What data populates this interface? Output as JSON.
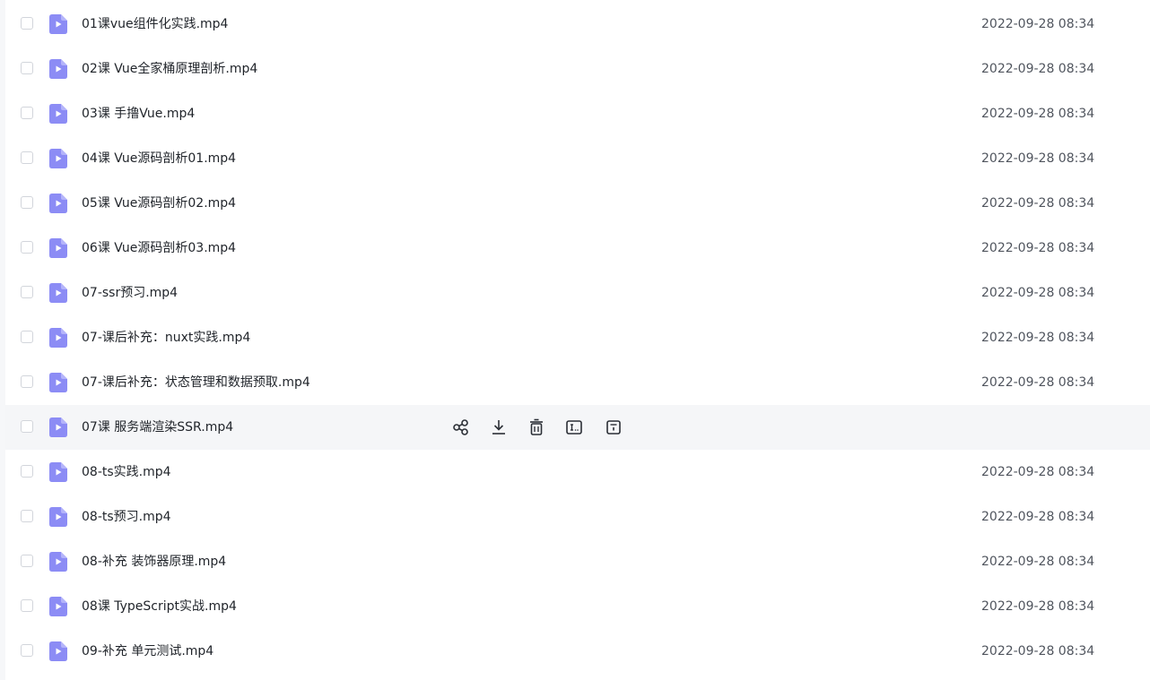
{
  "files": [
    {
      "name": "01课vue组件化实践.mp4",
      "date": "2022-09-28 08:34"
    },
    {
      "name": "02课 Vue全家桶原理剖析.mp4",
      "date": "2022-09-28 08:34"
    },
    {
      "name": "03课 手撸Vue.mp4",
      "date": "2022-09-28 08:34"
    },
    {
      "name": "04课 Vue源码剖析01.mp4",
      "date": "2022-09-28 08:34"
    },
    {
      "name": "05课 Vue源码剖析02.mp4",
      "date": "2022-09-28 08:34"
    },
    {
      "name": "06课 Vue源码剖析03.mp4",
      "date": "2022-09-28 08:34"
    },
    {
      "name": "07-ssr预习.mp4",
      "date": "2022-09-28 08:34"
    },
    {
      "name": "07-课后补充：nuxt实践.mp4",
      "date": "2022-09-28 08:34"
    },
    {
      "name": "07-课后补充：状态管理和数据预取.mp4",
      "date": "2022-09-28 08:34"
    },
    {
      "name": "07课  服务端渲染SSR.mp4",
      "date": ""
    },
    {
      "name": "08-ts实践.mp4",
      "date": "2022-09-28 08:34"
    },
    {
      "name": "08-ts预习.mp4",
      "date": "2022-09-28 08:34"
    },
    {
      "name": "08-补充 装饰器原理.mp4",
      "date": "2022-09-28 08:34"
    },
    {
      "name": "08课  TypeScript实战.mp4",
      "date": "2022-09-28 08:34"
    },
    {
      "name": "09-补充 单元测试.mp4",
      "date": "2022-09-28 08:34"
    }
  ],
  "hovered_index": 9,
  "row_actions": [
    "share-icon",
    "download-icon",
    "delete-icon",
    "rename-icon",
    "info-icon"
  ],
  "colors": {
    "file_icon": "#8c8cf5",
    "file_icon_fold": "#b4b4fa",
    "hover_bg": "#f5f6f8",
    "text": "#1f2329",
    "date_text": "#50555e",
    "action_icon": "#2b2f36"
  }
}
